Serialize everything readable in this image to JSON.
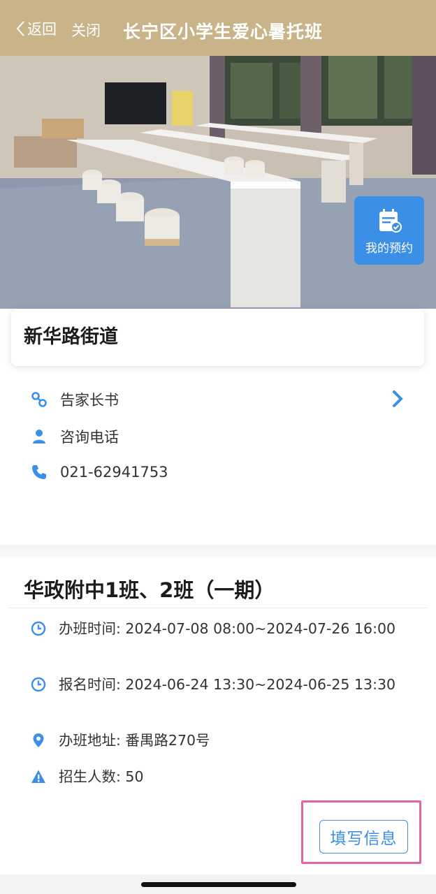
{
  "header": {
    "back_label": "返回",
    "close_label": "关闭",
    "title": "长宁区小学生爱心暑托班"
  },
  "hero": {
    "reserve_label": "我的预约",
    "reserve_icon": "calendar-check-icon"
  },
  "street": {
    "name": "新华路街道"
  },
  "info": {
    "notice_label": "告家长书",
    "consult_label": "咨询电话",
    "phone": "021-62941753"
  },
  "class": {
    "title": "华政附中1班、2班（一期）",
    "class_time": "办班时间: 2024-07-08 08:00~2024-07-26 16:00",
    "signup_time": "报名时间: 2024-06-24 13:30~2024-06-25 13:30",
    "address": "办班地址: 番禺路270号",
    "enrollment": "招生人数: 50",
    "fill_button": "填写信息"
  },
  "colors": {
    "header_bg": "#c9b48a",
    "accent": "#3b8fe6",
    "highlight": "#e2659e"
  }
}
